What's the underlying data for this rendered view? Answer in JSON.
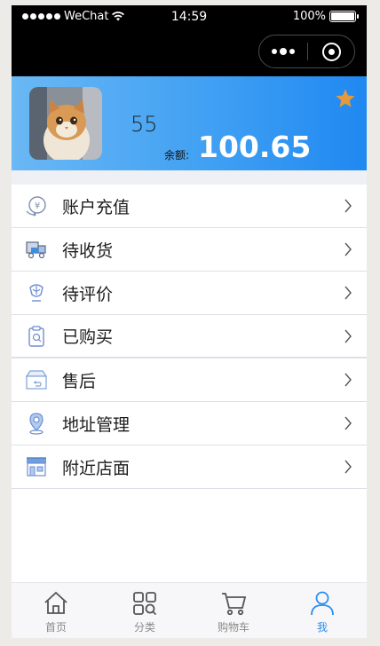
{
  "status_bar": {
    "carrier": "WeChat",
    "time": "14:59",
    "battery": "100%"
  },
  "profile": {
    "username": "55",
    "balance_label": "余额:",
    "balance_value": "100.65"
  },
  "menu": {
    "items": [
      {
        "label": "账户充值",
        "icon": "recharge-icon"
      },
      {
        "label": "待收货",
        "icon": "delivery-icon"
      },
      {
        "label": "待评价",
        "icon": "review-icon"
      },
      {
        "label": "已购买",
        "icon": "purchased-icon"
      },
      {
        "label": "售后",
        "icon": "after-sales-icon"
      },
      {
        "label": "地址管理",
        "icon": "location-icon"
      },
      {
        "label": "附近店面",
        "icon": "store-icon"
      }
    ]
  },
  "tabbar": {
    "tabs": [
      {
        "label": "首页",
        "icon": "home-icon"
      },
      {
        "label": "分类",
        "icon": "category-icon"
      },
      {
        "label": "购物车",
        "icon": "cart-icon"
      },
      {
        "label": "我",
        "icon": "user-icon",
        "active": true
      }
    ]
  },
  "colors": {
    "accent": "#2b8ff2",
    "header_start": "#6ab8f4",
    "header_end": "#1f88f1",
    "star": "#e39a3c"
  }
}
